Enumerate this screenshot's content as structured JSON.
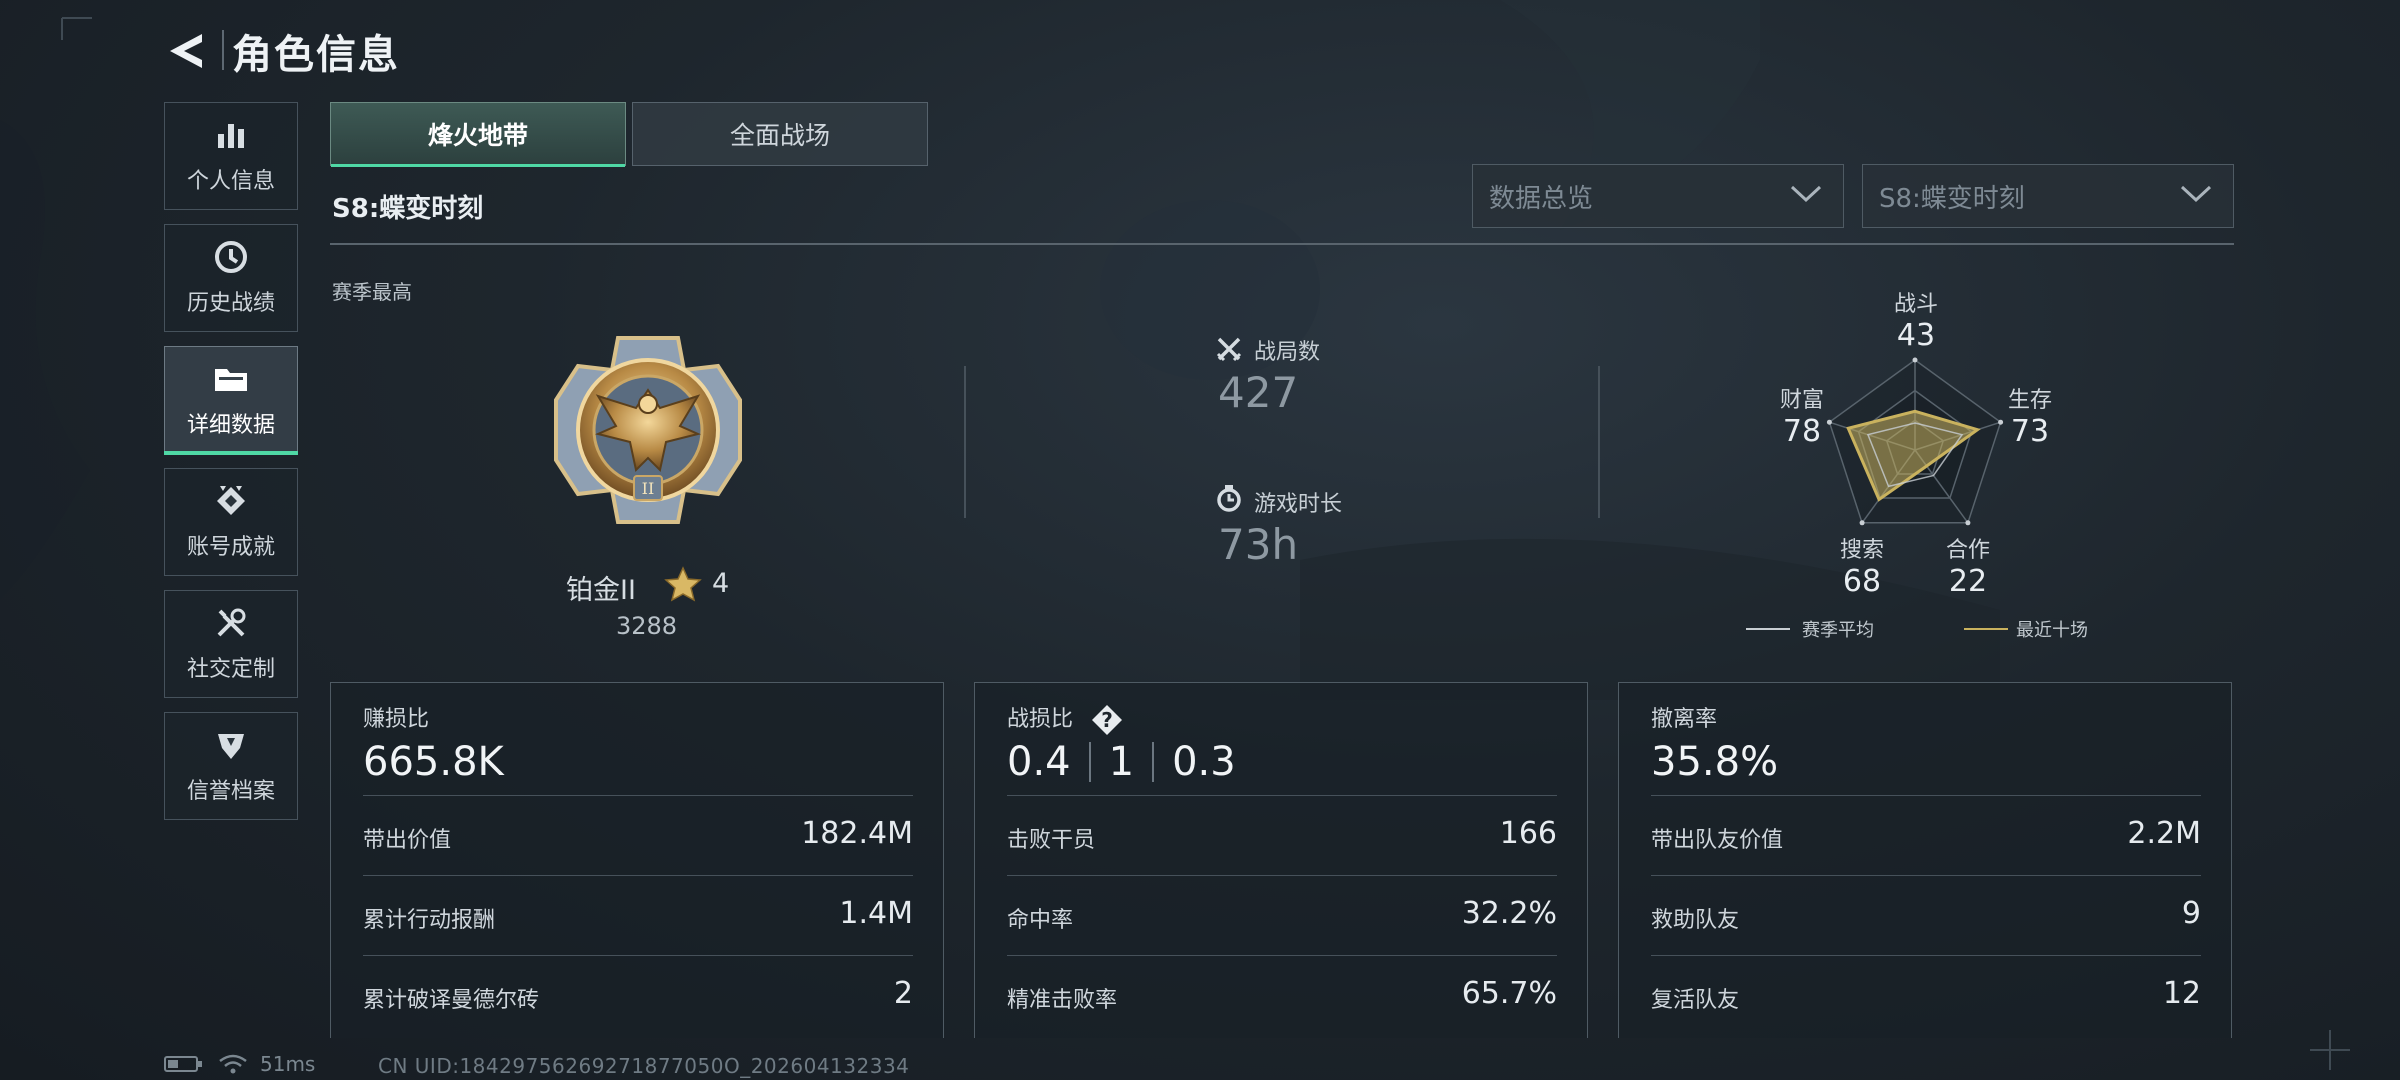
{
  "header": {
    "title": "角色信息"
  },
  "sidebar": {
    "items": [
      {
        "label": "个人信息",
        "icon": "bar-chart-icon"
      },
      {
        "label": "历史战绩",
        "icon": "clock-icon"
      },
      {
        "label": "详细数据",
        "icon": "folder-icon",
        "active": true
      },
      {
        "label": "账号成就",
        "icon": "badge-icon"
      },
      {
        "label": "社交定制",
        "icon": "tools-icon"
      },
      {
        "label": "信誉档案",
        "icon": "shield-icon"
      }
    ]
  },
  "tabs": [
    {
      "label": "烽火地带",
      "active": true
    },
    {
      "label": "全面战场",
      "active": false
    }
  ],
  "season": {
    "title": "S8:蝶变时刻",
    "best_label": "赛季最高"
  },
  "filters": {
    "view": "数据总览",
    "season": "S8:蝶变时刻"
  },
  "rank": {
    "name": "铂金II",
    "stars": "4",
    "score": "3288",
    "emblem_numeral": "II"
  },
  "summary": {
    "matches_label": "战局数",
    "matches_value": "427",
    "playtime_label": "游戏时长",
    "playtime_value": "73h"
  },
  "radar": {
    "axes": [
      {
        "name": "战斗",
        "value": "43",
        "level": 0.43
      },
      {
        "name": "生存",
        "value": "73",
        "level": 0.73
      },
      {
        "name": "合作",
        "value": "22",
        "level": 0.22
      },
      {
        "name": "搜索",
        "value": "68",
        "level": 0.68
      },
      {
        "name": "财富",
        "value": "78",
        "level": 0.78
      }
    ],
    "average_levels": [
      0.3,
      0.55,
      0.35,
      0.5,
      0.55
    ],
    "legend": {
      "season_avg": "赛季平均",
      "recent_ten": "最近十场"
    },
    "colors": {
      "recent": "#c9b25e",
      "average": "#c8ced3"
    }
  },
  "cards": {
    "profit": {
      "title": "赚损比",
      "big": "665.8K",
      "rows": [
        {
          "label": "带出价值",
          "value": "182.4M"
        },
        {
          "label": "累计行动报酬",
          "value": "1.4M"
        },
        {
          "label": "累计破译曼德尔砖",
          "value": "2"
        }
      ]
    },
    "combat": {
      "title": "战损比",
      "help": "?",
      "kd": [
        "0.4",
        "1",
        "0.3"
      ],
      "rows": [
        {
          "label": "击败干员",
          "value": "166"
        },
        {
          "label": "命中率",
          "value": "32.2%"
        },
        {
          "label": "精准击败率",
          "value": "65.7%"
        }
      ]
    },
    "extract": {
      "title": "撤离率",
      "big": "35.8%",
      "rows": [
        {
          "label": "带出队友价值",
          "value": "2.2M"
        },
        {
          "label": "救助队友",
          "value": "9"
        },
        {
          "label": "复活队友",
          "value": "12"
        }
      ]
    }
  },
  "status": {
    "ping": "51ms",
    "uid": "CN UID:18429756269271877050O_202604132334"
  },
  "accent": "#4fd8a5"
}
